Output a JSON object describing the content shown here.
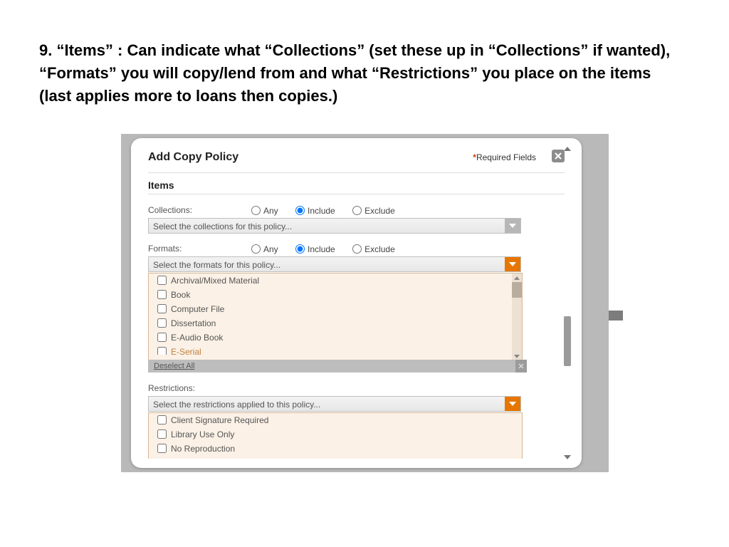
{
  "caption": "9. “Items” : Can indicate what “Collections” (set these up in “Collections” if wanted), “Formats” you will copy/lend from and what “Restrictions” you place on the items (last applies more to loans then copies.)",
  "dialog": {
    "title": "Add Copy Policy",
    "required_label": "Required Fields",
    "section_title": "Items",
    "radio_options": {
      "any": "Any",
      "include": "Include",
      "exclude": "Exclude"
    },
    "collections": {
      "label": "Collections:",
      "placeholder": "Select the collections for this policy...",
      "selected_mode": "include"
    },
    "formats": {
      "label": "Formats:",
      "placeholder": "Select the formats for this policy...",
      "selected_mode": "include",
      "options": [
        "Archival/Mixed Material",
        "Book",
        "Computer File",
        "Dissertation",
        "E-Audio Book",
        "E-Serial"
      ],
      "deselect_label": "Deselect All"
    },
    "restrictions": {
      "label": "Restrictions:",
      "placeholder": "Select the restrictions applied to this policy...",
      "options": [
        "Client Signature Required",
        "Library Use Only",
        "No Reproduction"
      ]
    }
  }
}
